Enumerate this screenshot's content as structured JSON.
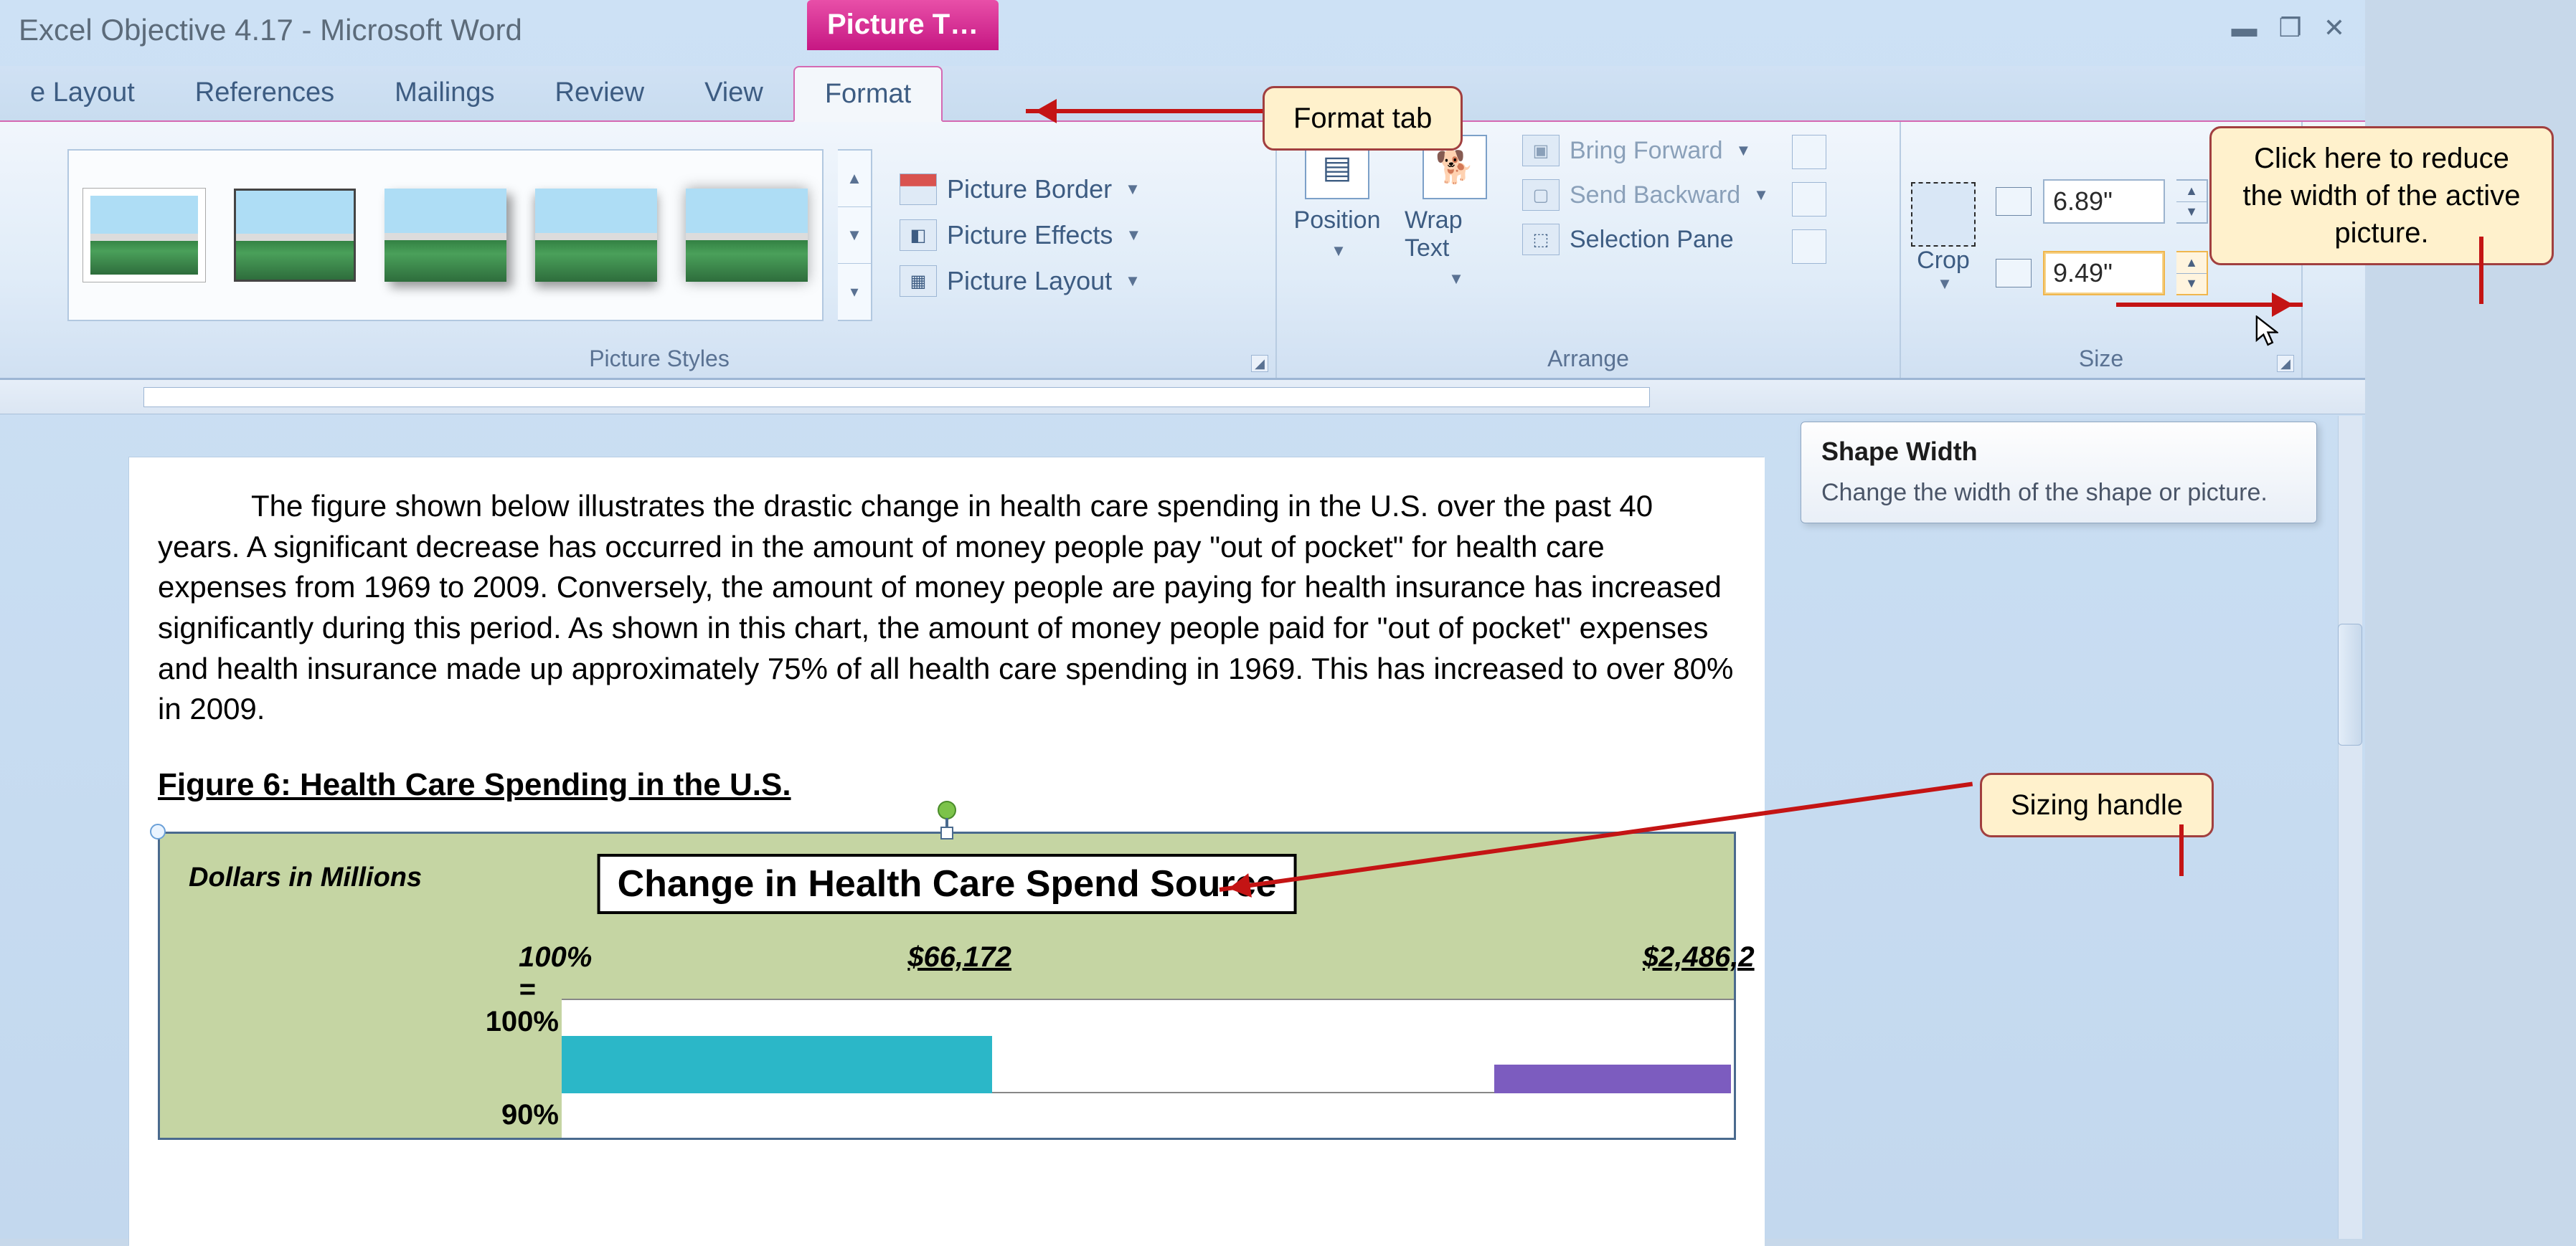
{
  "window": {
    "title": "Excel Objective 4.17  -  Microsoft Word",
    "contextual_tab": "Picture T…"
  },
  "tabs": [
    "e Layout",
    "References",
    "Mailings",
    "Review",
    "View",
    "Format"
  ],
  "ribbon": {
    "styles": {
      "label": "Picture Styles",
      "menu": [
        "Picture Border",
        "Picture Effects",
        "Picture Layout"
      ]
    },
    "arrange": {
      "label": "Arrange",
      "position": "Position",
      "wrap": "Wrap Text",
      "bring_forward": "Bring Forward",
      "send_backward": "Send Backward",
      "selection_pane": "Selection Pane"
    },
    "size": {
      "label": "Size",
      "crop": "Crop",
      "height": "6.89\"",
      "width": "9.49\""
    }
  },
  "tooltip": {
    "title": "Shape Width",
    "body": "Change the width of the shape or picture."
  },
  "callouts": {
    "format_tab": "Format tab",
    "reduce_width": "Click here to reduce the width of the active picture.",
    "sizing_handle": "Sizing handle"
  },
  "document": {
    "paragraph": "The figure shown below illustrates the drastic change in health care spending in the U.S. over the past 40 years.  A significant decrease has occurred in the amount of money people pay \"out of pocket\" for health care expenses from 1969 to 2009.  Conversely, the amount of money people are paying for health insurance has increased significantly during this period.  As shown in this chart, the amount of money people paid for \"out of pocket\" expenses and health insurance made up approximately 75% of all health care spending in 1969.  This has increased to over 80% in 2009.",
    "figure_caption": "Figure 6: Health Care Spending in the U.S."
  },
  "chart_data": {
    "type": "bar",
    "title": "Change in Health Care Spend Source",
    "ylabel": "Dollars in Millions",
    "hundred_label": "100% =",
    "column_totals": [
      "$66,172",
      "$2,486,2"
    ],
    "yticks": [
      "100%",
      "90%"
    ],
    "ylim": [
      0,
      100
    ]
  }
}
